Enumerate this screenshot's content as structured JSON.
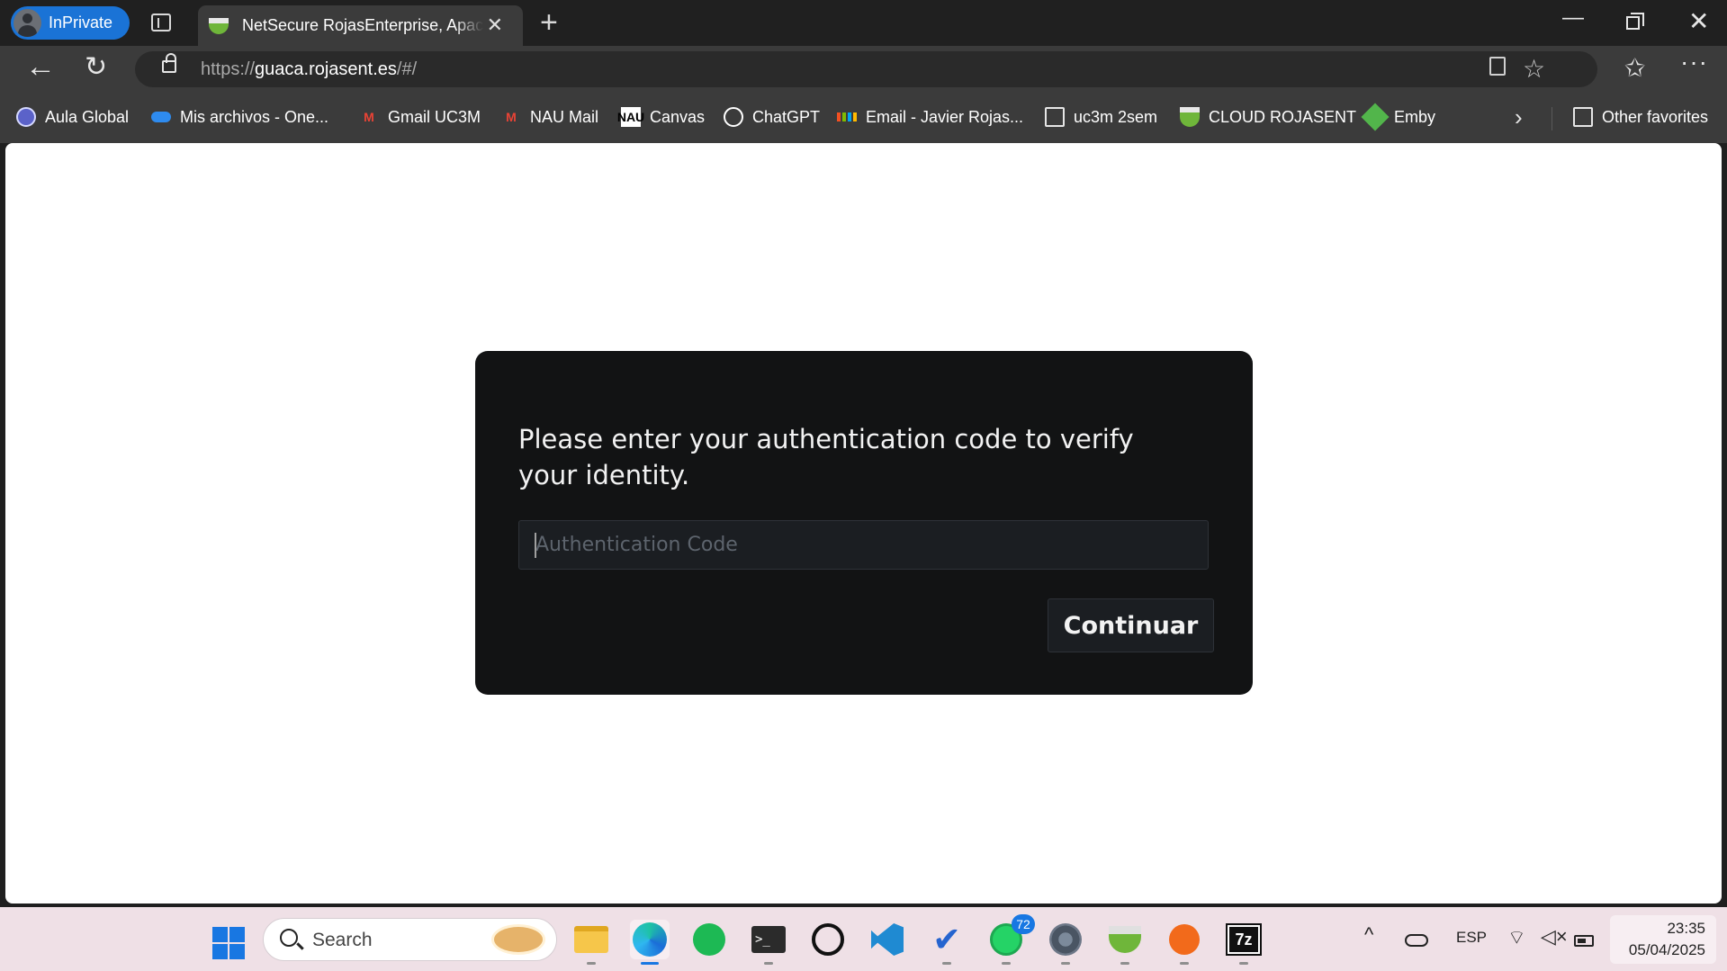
{
  "browser": {
    "profile_label": "InPrivate",
    "active_tab_title": "NetSecure RojasEnterprise, Apache Guacamole",
    "url_scheme": "https://",
    "url_host": "guaca.rojasent.es",
    "url_path": "/#/"
  },
  "bookmarks": {
    "items": [
      {
        "label": "Aula Global",
        "icon": "aula-global-icon"
      },
      {
        "label": "Mis archivos - One...",
        "icon": "onedrive-icon"
      },
      {
        "label": "Gmail UC3M",
        "icon": "gmail-icon"
      },
      {
        "label": "NAU Mail",
        "icon": "gmail-icon"
      },
      {
        "label": "Canvas",
        "icon": "nau-icon"
      },
      {
        "label": "ChatGPT",
        "icon": "chatgpt-icon"
      },
      {
        "label": "Email - Javier Rojas...",
        "icon": "microsoft-icon"
      },
      {
        "label": "uc3m 2sem",
        "icon": "folder-icon"
      },
      {
        "label": "CLOUD ROJASENT",
        "icon": "rojasent-icon"
      },
      {
        "label": "Emby",
        "icon": "emby-icon"
      }
    ],
    "other_favorites": "Other favorites"
  },
  "dialog": {
    "prompt": "Please enter your authentication code to verify your identity.",
    "input_placeholder": "Authentication Code",
    "submit_label": "Continuar"
  },
  "taskbar": {
    "search_label": "Search",
    "whatsapp_badge": "72",
    "language": "ESP",
    "time": "23:35",
    "date": "05/04/2025"
  },
  "colors": {
    "page_background": "#ffffff",
    "dialog_background": "#121314",
    "accent": "#1a73d6"
  }
}
